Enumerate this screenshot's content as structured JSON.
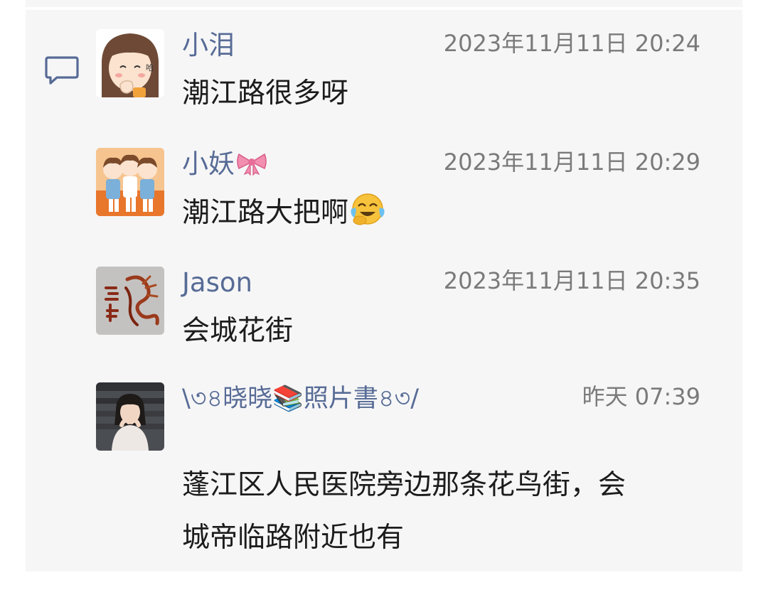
{
  "comments": [
    {
      "nickname": "小泪",
      "timestamp": "2023年11月11日 20:24",
      "content": "潮江路很多呀",
      "avatar": "cartoon-girl-bangs-avatar"
    },
    {
      "nickname": "小妖",
      "nickname_emoji": "ribbon-bow",
      "timestamp": "2023年11月11日 20:29",
      "content": "潮江路大把啊",
      "content_emoji": "laughing-crying-face",
      "avatar": "cartoon-kids-group-avatar"
    },
    {
      "nickname": "Jason",
      "timestamp": "2023年11月11日 20:35",
      "content": "会城花街",
      "avatar": "dragon-calligraphy-avatar"
    },
    {
      "nickname": "ꦿ꧂晓晓📚照片書꧂ꦿ",
      "nickname_display": "\\৩৪晓晓📚照片書৪৩/",
      "timestamp": "昨天 07:39",
      "content_line1": "蓬江区人民医院旁边那条花鸟街，会",
      "content_line2": "城帝临路附近也有",
      "avatar": "child-photo-avatar"
    }
  ],
  "colors": {
    "panel_background": "#f6f6f7",
    "nickname": "#576b95",
    "timestamp": "#7a7a7a",
    "content": "#1c1c1c"
  },
  "icons": {
    "comment_icon": "comment-bubble-icon"
  }
}
